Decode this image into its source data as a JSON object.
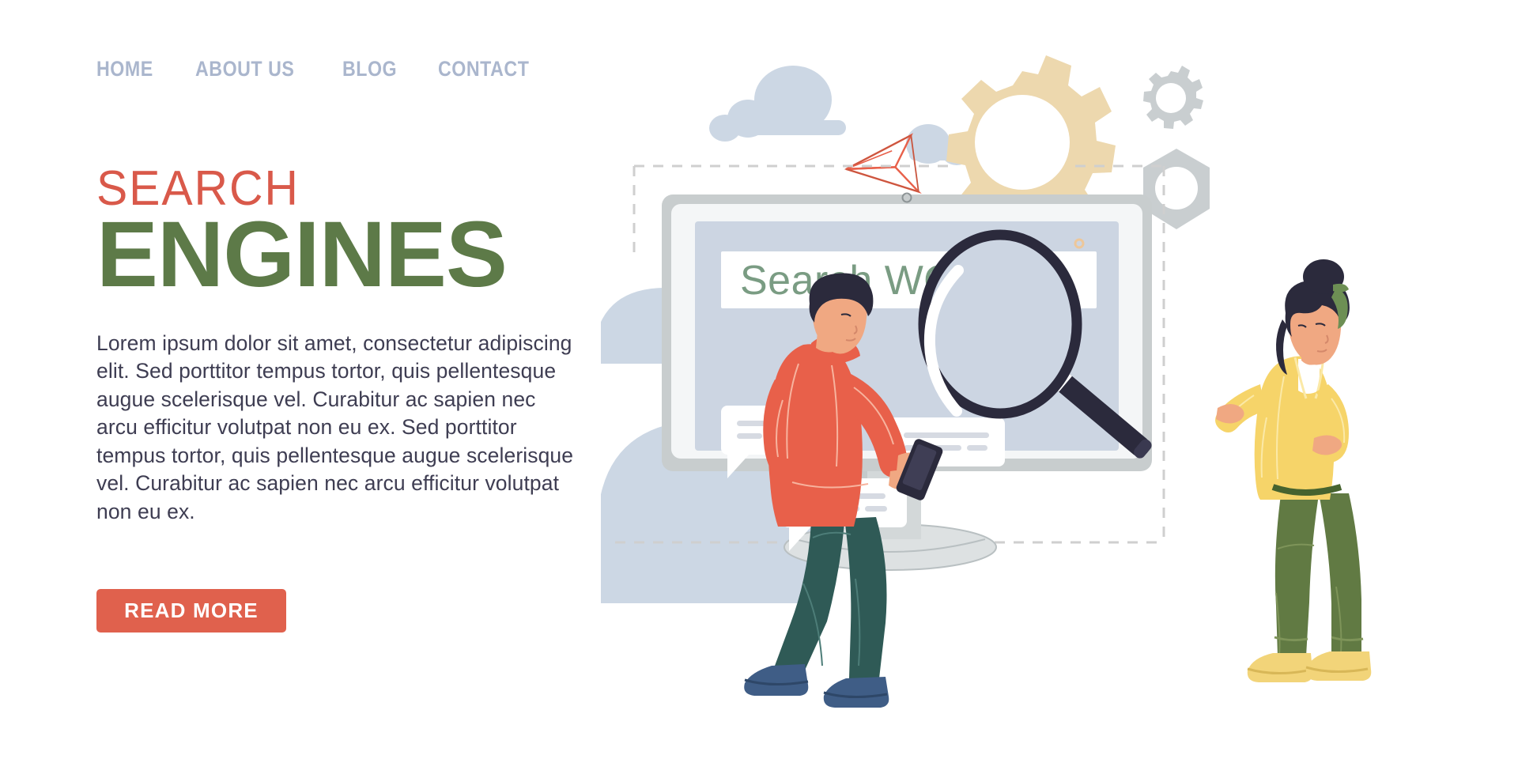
{
  "nav": {
    "items": [
      {
        "label": "HOME",
        "name": "nav-item-home"
      },
      {
        "label": "ABOUT US",
        "name": "nav-item-about-us"
      },
      {
        "label": "BLOG",
        "name": "nav-item-blog"
      },
      {
        "label": "CONTACT",
        "name": "nav-item-contact"
      }
    ]
  },
  "hero": {
    "title_top": "SEARCH",
    "title_bottom": "ENGINES",
    "body": "Lorem ipsum dolor sit amet, consectetur adipiscing elit. Sed porttitor tempus tortor, quis pellentesque augue scelerisque vel. Curabitur ac sapien nec arcu efficitur volutpat non eu ex. Sed porttitor tempus tortor, quis pellentesque augue scelerisque vel. Curabitur ac sapien nec arcu efficitur volutpat non eu ex.",
    "cta_label": "READ MORE"
  },
  "illustration": {
    "search_bar_text": "Search WORK",
    "icons": [
      "cloud-icon",
      "cloud-icon",
      "cloud-icon",
      "paper-plane-icon",
      "gear-icon",
      "small-gear-icon",
      "nut-icon",
      "magnifier-icon",
      "monitor-icon",
      "smartphone-icon",
      "speech-bubble-icon",
      "webcam-dot-icon",
      "person-man",
      "person-woman"
    ]
  },
  "colors": {
    "nav_text": "#aab6cd",
    "title_top": "#d9594a",
    "title_bottom": "#5d7a48",
    "body_text": "#3e3d52",
    "cta_bg": "#e0614d",
    "cta_text": "#ffffff",
    "cloud": "#ccd7e4",
    "screen_bg": "#ccd5e2",
    "monitor_frame": "#c8cdce",
    "search_text": "#7a9c83",
    "gear_large": "#edd8ae",
    "gear_small": "#c8cdce",
    "hoodie": "#e8604a",
    "jeans": "#2f5a56",
    "sneakers_blue": "#3f5d86",
    "blouse": "#f6d469",
    "pants_olive": "#617a43",
    "sneakers_yellow": "#f2d479",
    "hair": "#2b2a3c",
    "skin": "#f0a882",
    "dashed": "#cfcfcf"
  }
}
